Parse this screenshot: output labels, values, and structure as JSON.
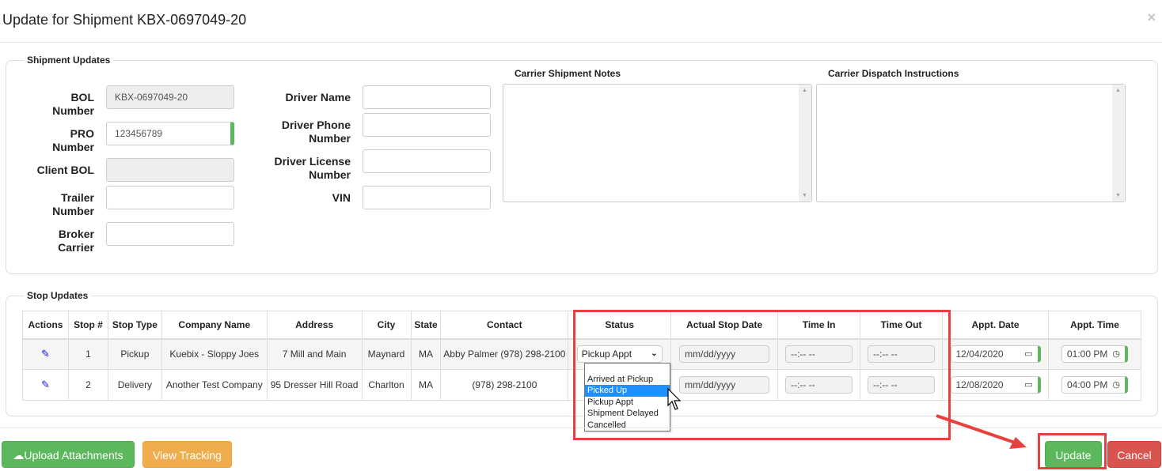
{
  "modal": {
    "title": "Update for Shipment KBX-0697049-20",
    "close_icon": "×"
  },
  "shipment_updates": {
    "legend": "Shipment Updates",
    "fields_left": [
      {
        "label_line1": "BOL",
        "label_line2": "Number",
        "value": "KBX-0697049-20",
        "readonly": true
      },
      {
        "label_line1": "PRO",
        "label_line2": "Number",
        "value": "123456789",
        "readonly": false
      },
      {
        "label_line1": "Client BOL",
        "label_line2": "",
        "value": "",
        "readonly": true
      },
      {
        "label_line1": "Trailer",
        "label_line2": "Number",
        "value": "",
        "readonly": false
      },
      {
        "label_line1": "Broker",
        "label_line2": "Carrier",
        "value": "",
        "readonly": false
      }
    ],
    "fields_mid": [
      {
        "label_line1": "Driver Name",
        "label_line2": "",
        "value": ""
      },
      {
        "label_line1": "Driver Phone",
        "label_line2": "Number",
        "value": ""
      },
      {
        "label_line1": "Driver License",
        "label_line2": "Number",
        "value": ""
      },
      {
        "label_line1": "VIN",
        "label_line2": "",
        "value": ""
      }
    ],
    "carrier_notes_label": "Carrier Shipment Notes",
    "carrier_notes_value": "",
    "dispatch_label": "Carrier Dispatch Instructions",
    "dispatch_value": ""
  },
  "stop_updates": {
    "legend": "Stop Updates",
    "columns": [
      "Actions",
      "Stop #",
      "Stop Type",
      "Company Name",
      "Address",
      "City",
      "State",
      "Contact",
      "Status",
      "Actual Stop Date",
      "Time In",
      "Time Out",
      "Appt. Date",
      "Appt. Time"
    ],
    "rows": [
      {
        "stop": "1",
        "type": "Pickup",
        "company": "Kuebix - Sloppy Joes",
        "address": "7 Mill and Main",
        "city": "Maynard",
        "state": "MA",
        "contact": "Abby Palmer (978) 298-2100",
        "status": "Pickup Appt",
        "actual_date": "mm/dd/yyyy",
        "time_in": "--:-- --",
        "time_out": "--:-- --",
        "appt_date": "12/04/2020",
        "appt_time": "01:00 PM"
      },
      {
        "stop": "2",
        "type": "Delivery",
        "company": "Another Test Company",
        "address": "95 Dresser Hill Road",
        "city": "Charlton",
        "state": "MA",
        "contact": "(978) 298-2100",
        "status": "",
        "actual_date": "mm/dd/yyyy",
        "time_in": "--:-- --",
        "time_out": "--:-- --",
        "appt_date": "12/08/2020",
        "appt_time": "04:00 PM"
      }
    ],
    "status_options": [
      "",
      "Arrived at Pickup",
      "Picked Up",
      "Pickup Appt",
      "Shipment Delayed",
      "Cancelled"
    ],
    "highlighted_option": "Picked Up"
  },
  "footer": {
    "upload_label": "Upload Attachments",
    "tracking_label": "View Tracking",
    "update_label": "Update",
    "cancel_label": "Cancel"
  },
  "colors": {
    "green": "#5cb85c",
    "orange": "#f0ad4e",
    "red": "#d9534f",
    "annotation": "#e8403f",
    "option_highlight": "#1e90ff"
  }
}
